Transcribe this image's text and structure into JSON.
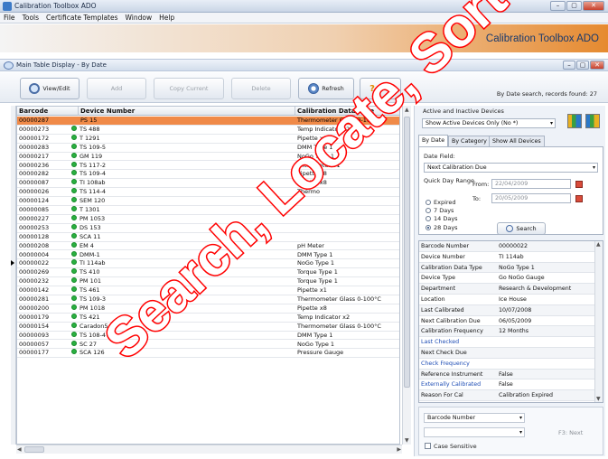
{
  "window": {
    "title": "Calibration Toolbox ADO",
    "controls": [
      "–",
      "▢",
      "✕"
    ]
  },
  "menu": [
    "File",
    "Tools",
    "Certificate Templates",
    "Window",
    "Help"
  ],
  "banner": {
    "title": "Calibration Toolbox ADO"
  },
  "subwindow": {
    "title": "Main Table Display - By Date"
  },
  "toolbar": {
    "view_edit": "View/Edit",
    "add": "Add",
    "copy_current": "Copy Current",
    "delete": "Delete",
    "refresh": "Refresh",
    "help": "Help"
  },
  "status": "By Date search, records found: 27",
  "grid": {
    "headers": [
      "Barcode Number",
      "Device Number",
      "Calibration Data Type"
    ],
    "rows": [
      {
        "barcode": "00000287",
        "device": "PS 15",
        "type": "Thermometer Glass 0-100°C",
        "selected": true
      },
      {
        "barcode": "00000273",
        "device": "TS 488",
        "type": "Temp Indicator x2"
      },
      {
        "barcode": "00000172",
        "device": "T 1291",
        "type": "Pipette x8"
      },
      {
        "barcode": "00000283",
        "device": "TS 109-5",
        "type": "DMM Type 1"
      },
      {
        "barcode": "00000217",
        "device": "GM 119",
        "type": "NoGo Type 1"
      },
      {
        "barcode": "00000236",
        "device": "TS 117-2",
        "type": "Micrometer V1"
      },
      {
        "barcode": "00000282",
        "device": "TS 109-4",
        "type": "Pipette x8"
      },
      {
        "barcode": "00000087",
        "device": "TI 108ab",
        "type": "Pipette x8"
      },
      {
        "barcode": "00000026",
        "device": "TS 114-4",
        "type": "Thermo"
      },
      {
        "barcode": "00000124",
        "device": "SEM 120",
        "type": ""
      },
      {
        "barcode": "00000085",
        "device": "T 1301",
        "type": ""
      },
      {
        "barcode": "00000227",
        "device": "PM 1053",
        "type": ""
      },
      {
        "barcode": "00000253",
        "device": "DS 153",
        "type": ""
      },
      {
        "barcode": "00000128",
        "device": "SCA 11",
        "type": ""
      },
      {
        "barcode": "00000208",
        "device": "EM 4",
        "type": "pH Meter"
      },
      {
        "barcode": "00000004",
        "device": "DMM-1",
        "type": "DMM Type 1"
      },
      {
        "barcode": "00000022",
        "device": "TI 114ab",
        "type": "NoGo Type 1",
        "current": true
      },
      {
        "barcode": "00000269",
        "device": "TS 410",
        "type": "Torque Type 1"
      },
      {
        "barcode": "00000232",
        "device": "PM 101",
        "type": "Torque Type 1"
      },
      {
        "barcode": "00000142",
        "device": "TS 461",
        "type": "Pipette x1"
      },
      {
        "barcode": "00000281",
        "device": "TS 109-3",
        "type": "Thermometer Glass 0-100°C"
      },
      {
        "barcode": "00000200",
        "device": "PM 1018",
        "type": "Pipette x8"
      },
      {
        "barcode": "00000179",
        "device": "TS 421",
        "type": "Temp Indicator x2"
      },
      {
        "barcode": "00000154",
        "device": "Caradon5",
        "type": "Thermometer Glass 0-100°C"
      },
      {
        "barcode": "00000093",
        "device": "TS 108-4",
        "type": "DMM Type 1"
      },
      {
        "barcode": "00000057",
        "device": "SC 27",
        "type": "NoGo Type 1"
      },
      {
        "barcode": "00000177",
        "device": "SCA 126",
        "type": "Pressure Gauge"
      }
    ]
  },
  "panel": {
    "active_label": "Active and Inactive Devices",
    "active_combo": "Show Active Devices Only (No *)",
    "tabs": [
      "By Date",
      "By Category",
      "Show All Devices"
    ],
    "field_label": "Date Field:",
    "field_combo": "Next Calibration Due",
    "from_label": "From:",
    "from_value": "22/04/2009",
    "to_label": "To:",
    "to_value": "20/05/2009",
    "range_label": "Quick Day Range",
    "radios": [
      "Expired",
      "7 Days",
      "14 Days",
      "28 Days"
    ],
    "search_button": "Search",
    "properties": [
      {
        "k": "Barcode Number",
        "v": "00000022"
      },
      {
        "k": "Device Number",
        "v": "TI 114ab"
      },
      {
        "k": "Calibration Data Type",
        "v": "NoGo Type 1"
      },
      {
        "k": "Device Type",
        "v": "Go NoGo Gauge"
      },
      {
        "k": "Department",
        "v": "Research & Development"
      },
      {
        "k": "Location",
        "v": "Ice House"
      },
      {
        "k": "Last Calibrated",
        "v": "10/07/2008"
      },
      {
        "k": "Next Calibration Due",
        "v": "06/05/2009"
      },
      {
        "k": "Calibration Frequency",
        "v": "12 Months"
      },
      {
        "k": "Last Checked",
        "v": "",
        "link": true
      },
      {
        "k": "Next Check Due",
        "v": ""
      },
      {
        "k": "Check Frequency",
        "v": "",
        "link": true
      },
      {
        "k": "Reference Instrument",
        "v": "False"
      },
      {
        "k": "Externally Calibrated",
        "v": "False",
        "link": true
      },
      {
        "k": "Reason For Cal",
        "v": "Calibration Expired"
      }
    ],
    "find_combo": "Barcode Number",
    "find_next": "F3: Next",
    "case_sensitive": "Case Sensitive"
  },
  "overlay_text": "Search, Locate, Sort",
  "colors": {
    "selected_row": "#f08a48",
    "overlay": "#ff0000",
    "status_dot": "#2ab040"
  }
}
